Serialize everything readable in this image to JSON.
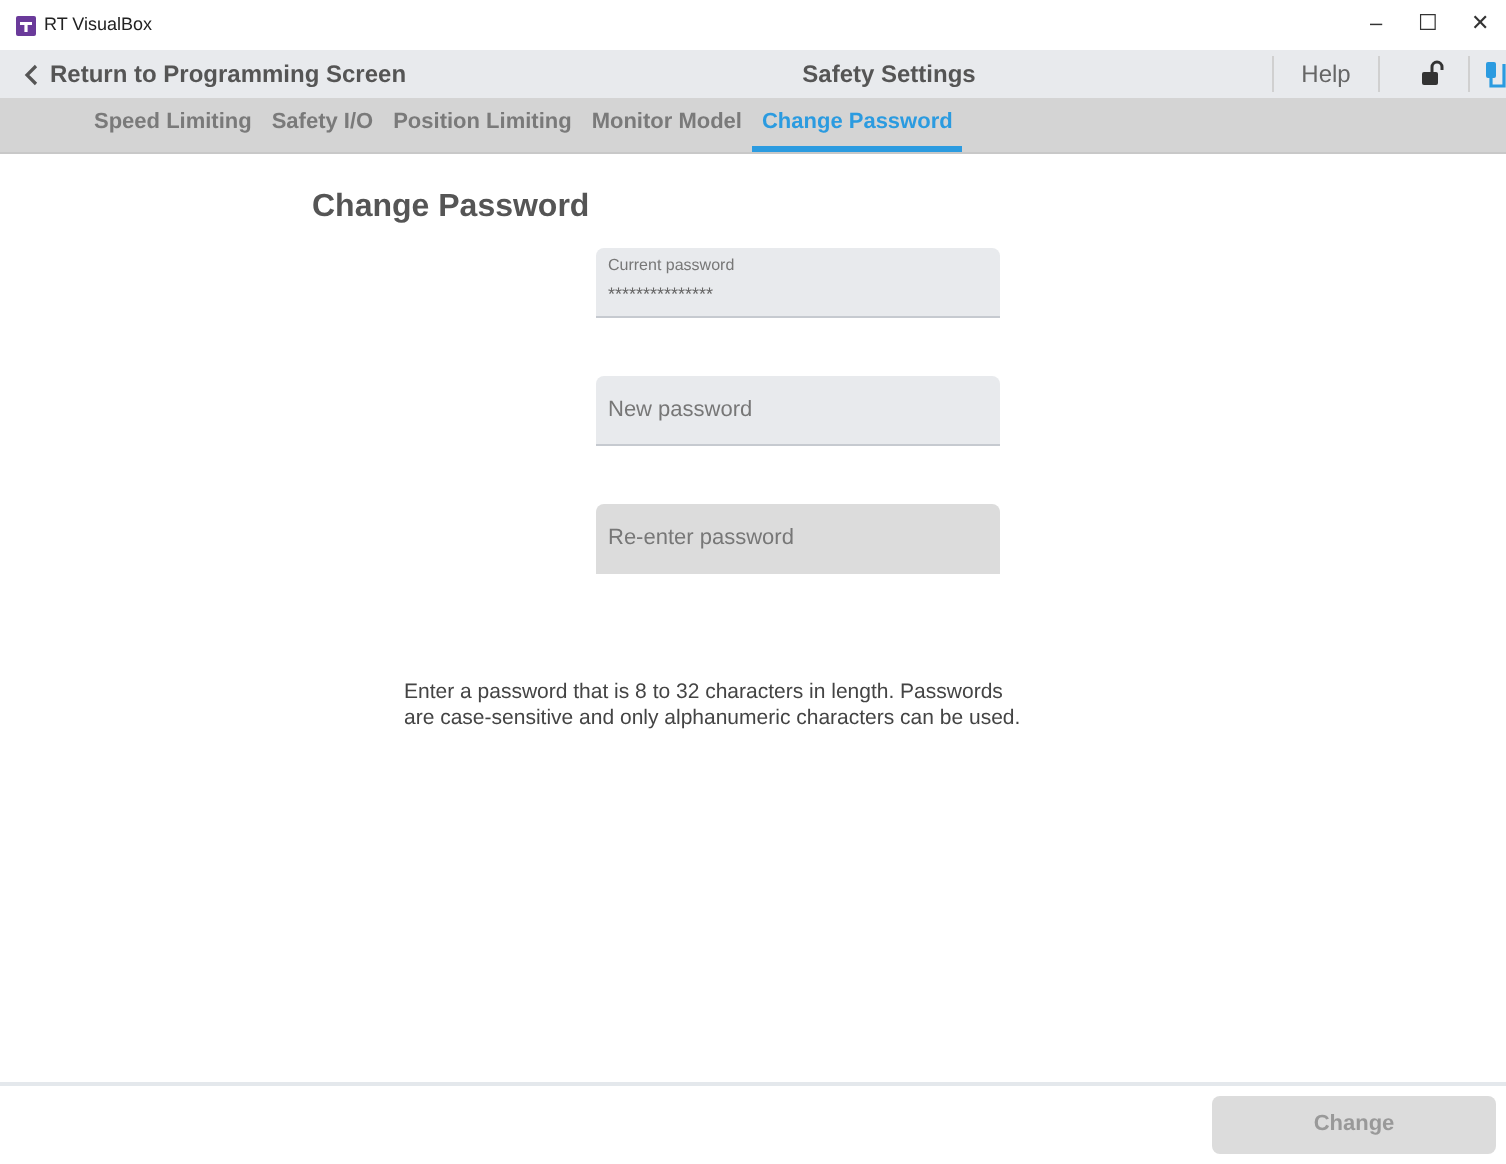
{
  "window": {
    "title": "RT VisualBox",
    "controls": [
      "–",
      "☐",
      "✕"
    ]
  },
  "header": {
    "back": "Return to Programming Screen",
    "title": "Safety Settings",
    "help": "Help"
  },
  "tabs": [
    {
      "label": "Speed Limiting",
      "selected": false
    },
    {
      "label": "Safety I/O",
      "selected": false
    },
    {
      "label": "Position Limiting",
      "selected": false
    },
    {
      "label": "Monitor Model",
      "selected": false
    },
    {
      "label": "Change Password",
      "selected": true
    }
  ],
  "heading": "Change Password",
  "fields": [
    {
      "label": "Current password",
      "value": "***************",
      "disabled": false
    },
    {
      "placeholder": "New password",
      "disabled": false
    },
    {
      "placeholder": "Re-enter password",
      "disabled": true
    }
  ],
  "note": "Enter a password that is 8 to 32 characters in length. Passwords are case-sensitive and only alphanumeric characters can be used.",
  "button": {
    "label": "Change",
    "disabled": true
  }
}
